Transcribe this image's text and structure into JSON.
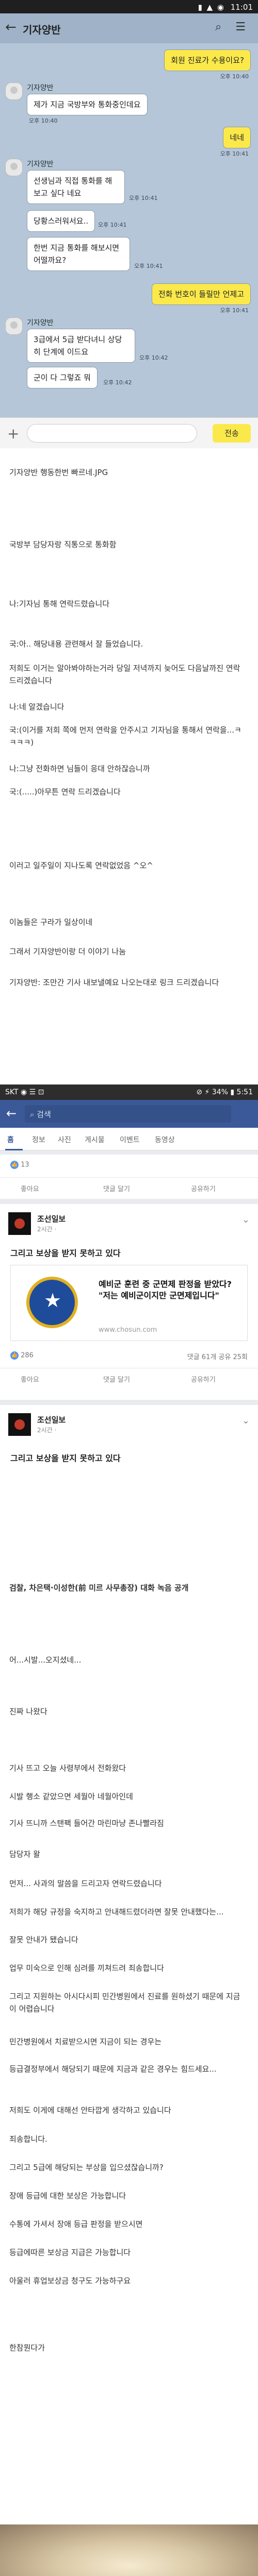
{
  "chat": {
    "status_time": "11:01",
    "status_icons": "▮ ▲ ◉",
    "title": "기자양반",
    "send_label": "전송",
    "messages": [
      {
        "from": "me",
        "text": "회원 진료가 수용이요?",
        "time": "오후 10:40"
      },
      {
        "from": "other",
        "sender": "기자양반",
        "text": "제가 지금 국방부와 통화중인데요",
        "time": "오후 10:40"
      },
      {
        "from": "me",
        "text": "네네",
        "time": "오후 10:41"
      },
      {
        "from": "other",
        "sender": "기자양반",
        "text": "선생님과 직접 통화를 해보고 싶다 네요",
        "time": "오후 10:41"
      },
      {
        "from": "other",
        "sender": "",
        "text": "당황스러워서요..",
        "time": "오후 10:41"
      },
      {
        "from": "other",
        "sender": "",
        "text": "한번 지금 통화를 해보시면 어떨까요?",
        "time": "오후 10:41"
      },
      {
        "from": "me",
        "text": "전화 번호이 들릴만 언제고",
        "time": "오후 10:41"
      },
      {
        "from": "other",
        "sender": "기자양반",
        "text": "3급에서 5급 받다녀니 상당히 단계에 이드요",
        "time": "오후 10:42"
      },
      {
        "from": "other",
        "sender": "",
        "text": "군이 다 그렇죠 뭐",
        "time": "오후 10:42"
      }
    ]
  },
  "post": {
    "paragraphs": [
      "기자양반 행동한번 빠르네.JPG",
      "국방부 담당자랑 직통으로 통화함",
      "나:기자님 통해 연락드렸습니다",
      "국:아.. 해당내용 관련해서 잘 들었습니다.",
      "저희도 이거는 알아봐야하는거라 당일 저녁까지 늦어도 다음날까진 연락 드리겠습니다",
      "나:네 알겠습니다",
      "국:(이거를 저희 쪽에 먼저 연락을 안주시고 기자님을 통해서 연락을...ㅋㅋㅋㅋ)",
      "나:그냥 전화하면 님들이 응대 안하잖슴니까",
      "국:(.....)아무튼 연락 드리겠습니다",
      "이러고 일주일이 지나도록 연락없었음 ^오^",
      "이놈들은 구라가 일상이네",
      "그래서 기자양반이랑 더 이야기 나눔",
      "기자양반: 조만간 기사 내보낼예요 나오는대로 링크 드리겠습니다",
      "검찰, 차은택·이성한(前 미르 사무총장) 대화 녹음 공개",
      "어...시발...오지셨네...",
      "진짜 나왔다",
      "기사 뜨고 오늘 사령부에서 전화왔다",
      "시발 행소 같았으면 세월아 네월아인데",
      "기사 뜨니까 스탠팩 들어간 마린마냥 존나빨라짐",
      "담당자 왈",
      "먼저... 사과의 말씀을 드리고자 연락드렸습니다",
      "저희가 해당 규정을 숙지하고 안내해드렸더라면 잘못 안내했다는...",
      "잘못 안내가 됐습니다",
      "업무 미숙으로 인해 심려를 끼쳐드려 죄송합니다",
      "그리고 지원하는 아시다시피 민간병원에서 진료를 원하셨기 때문에 지금이 어렵습니다",
      "민간병원에서 치료받으시면 지금이 되는 경우는",
      "등급결정부에서 해당되기 때문에 지금과 같은 경우는 힘드세요...",
      "저희도 이게에 대해선 안타깝게 생각하고 있습니다",
      "죄송합니다.",
      "그리고 5급에 해당되는 부상을 입으셨잖습니까?",
      "장애 등급에 대한 보상은 가능합니다",
      "수통에 가셔서 장애 등급 판정을 받으시면",
      "등급에따른 보상금 지급은 가능합니다",
      "아울러 휴업보상금 청구도 가능하구요",
      "한참뭔다가"
    ]
  },
  "facebook": {
    "status_left": "SKT ◉ ☰ ⊡",
    "status_right": "⊘ ⚡ 34% ▮ 5:51",
    "search_placeholder": "검색",
    "tabs": [
      "홈",
      "정보",
      "사진",
      "게시물",
      "이벤트",
      "동영상"
    ],
    "likes_1": "13",
    "like_label": "좋아요",
    "comment_label": "댓글 달기",
    "share_label": "공유하기",
    "page_name": "조선일보",
    "post1_time": "2시간 ·",
    "post1_title": "그리고 보상을 받지 못하고 있다",
    "link_headline": "예비군 훈련 중 군면제 판정을 받았다? \"저는 예비군이지만 군면제입니다\"",
    "link_url": "www.chosun.com",
    "post1_likes": "286",
    "post1_stats": "댓글 61개 공유 25회",
    "post2_time": "2시간 ·",
    "post2_caption": "그리고 보상을 받지 못하고 있다"
  }
}
